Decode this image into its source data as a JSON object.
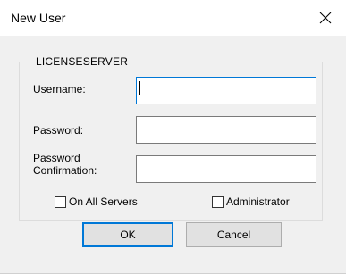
{
  "window": {
    "title": "New User",
    "close_icon": "close-icon"
  },
  "group": {
    "legend": "LICENSESERVER"
  },
  "fields": {
    "username_label": "Username:",
    "username_value": "",
    "password_label": "Password:",
    "password_value": "",
    "confirm_label_line1": "Password",
    "confirm_label_line2": "Confirmation:",
    "confirm_value": ""
  },
  "options": {
    "all_servers_label": "On All Servers",
    "all_servers_checked": false,
    "administrator_label": "Administrator",
    "administrator_checked": false
  },
  "buttons": {
    "ok_label": "OK",
    "cancel_label": "Cancel"
  },
  "colors": {
    "focus_accent": "#0078d7",
    "dialog_background": "#f0f0f0"
  }
}
